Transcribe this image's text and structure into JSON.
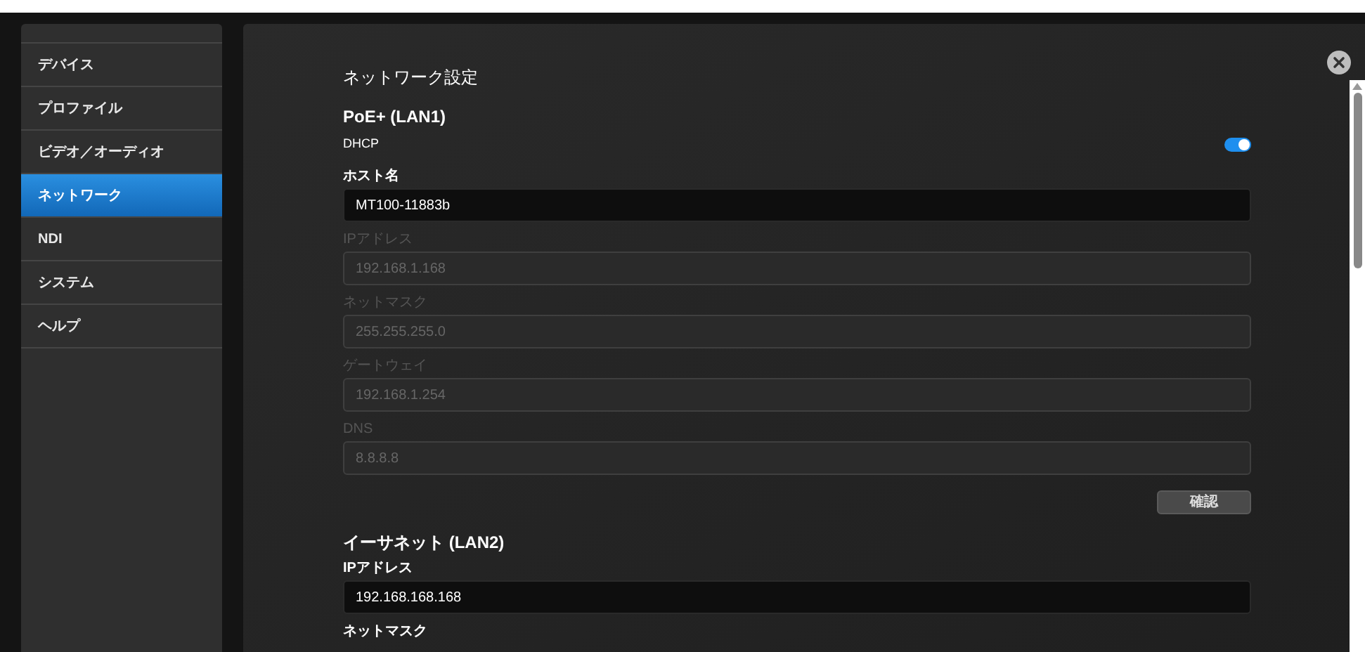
{
  "sidebar": {
    "items": [
      {
        "label": "デバイス",
        "selected": false
      },
      {
        "label": "プロファイル",
        "selected": false
      },
      {
        "label": "ビデオ／オーディオ",
        "selected": false
      },
      {
        "label": "ネットワーク",
        "selected": true
      },
      {
        "label": "NDI",
        "selected": false
      },
      {
        "label": "システム",
        "selected": false
      },
      {
        "label": "ヘルプ",
        "selected": false
      }
    ]
  },
  "panel": {
    "title": "ネットワーク設定",
    "sections": [
      {
        "heading": "PoE+ (LAN1)",
        "dhcp": {
          "label": "DHCP",
          "on": true
        },
        "fields": [
          {
            "label": "ホスト名",
            "value": "MT100-11883b",
            "disabled": false
          },
          {
            "label": "IPアドレス",
            "value": "192.168.1.168",
            "disabled": true
          },
          {
            "label": "ネットマスク",
            "value": "255.255.255.0",
            "disabled": true
          },
          {
            "label": "ゲートウェイ",
            "value": "192.168.1.254",
            "disabled": true
          },
          {
            "label": "DNS",
            "value": "8.8.8.8",
            "disabled": true
          }
        ],
        "button": "確認"
      },
      {
        "heading": "イーサネット (LAN2)",
        "fields": [
          {
            "label": "IPアドレス",
            "value": "192.168.168.168",
            "disabled": false
          },
          {
            "label": "ネットマスク",
            "disabled": false
          }
        ]
      }
    ]
  }
}
